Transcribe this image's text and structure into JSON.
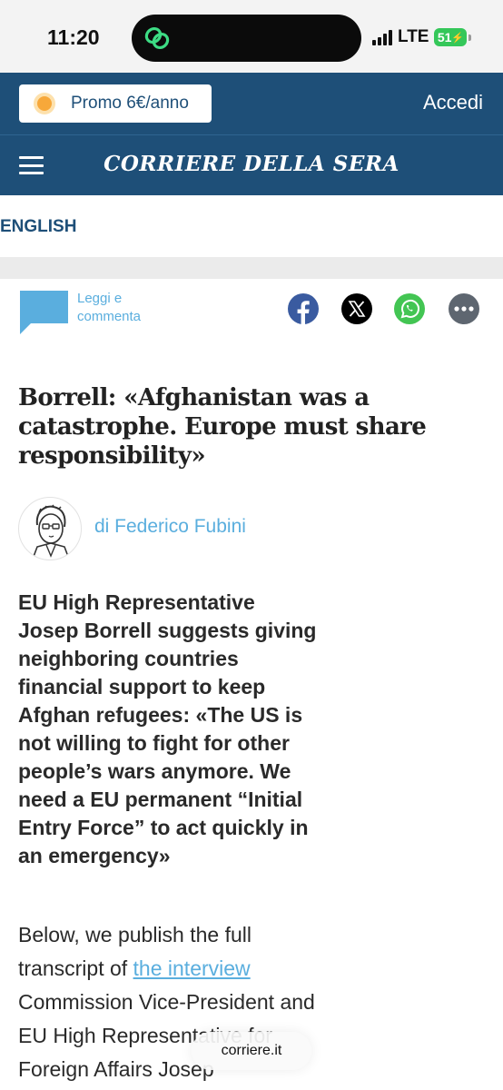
{
  "status_bar": {
    "time": "11:20",
    "network": "LTE",
    "battery": "51",
    "battery_color": "#34c759"
  },
  "promo": {
    "label": "Promo 6€/anno",
    "icon": "sun-dot-icon"
  },
  "header": {
    "login": "Accedi",
    "logo": "CORRIERE DELLA SERA",
    "brand_color": "#1e4f78"
  },
  "section": {
    "label": "ENGLISH"
  },
  "share": {
    "comment_label": "Leggi e commenta",
    "icons": [
      "facebook-icon",
      "x-icon",
      "whatsapp-icon",
      "more-icon"
    ]
  },
  "article": {
    "headline": "Borrell: «Afghanistan was a catastrophe. Europe must share responsibility»",
    "author": "di Federico Fubini",
    "summary": "EU High Representative Josep Borrell suggests giving neighboring countries financial support to keep Afghan refugees: «The US is not willing to fight for other people’s wars anymore. We need a EU permanent “Initial Entry Force” to act quickly in an emergency»",
    "body_before_link": "Below, we publish the full transcript of ",
    "body_link": "the interview",
    "body_after_link": " Commission Vice-President and EU High Representative for Foreign Affairs Josep"
  },
  "browser": {
    "domain": "corriere.it"
  },
  "accent_color": "#5aaede"
}
